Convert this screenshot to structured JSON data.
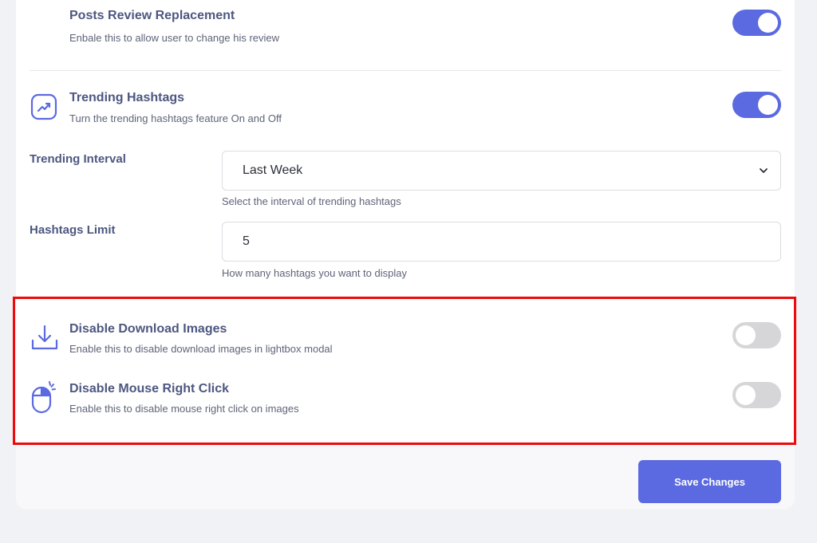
{
  "settings": {
    "posts_review": {
      "title": "Posts Review Replacement",
      "description": "Enbale this to allow user to change his review",
      "enabled": true
    },
    "trending_hashtags": {
      "title": "Trending Hashtags",
      "description": "Turn the trending hashtags feature On and Off",
      "enabled": true,
      "icon": "trending-up-icon"
    },
    "trending_interval": {
      "label": "Trending Interval",
      "value": "Last Week",
      "help": "Select the interval of trending hashtags"
    },
    "hashtags_limit": {
      "label": "Hashtags Limit",
      "value": "5",
      "help": "How many hashtags you want to display"
    },
    "disable_download": {
      "title": "Disable Download Images",
      "description": "Enable this to disable download images in lightbox modal",
      "enabled": false,
      "icon": "download-icon"
    },
    "disable_right_click": {
      "title": "Disable Mouse Right Click",
      "description": "Enable this to disable mouse right click on images",
      "enabled": false,
      "icon": "mouse-click-icon"
    }
  },
  "footer": {
    "save_label": "Save Changes"
  },
  "colors": {
    "accent": "#5b6ae0",
    "toggle_off": "#d6d6d9",
    "highlight_border": "#ee0a0a",
    "background": "#f1f2f6"
  }
}
